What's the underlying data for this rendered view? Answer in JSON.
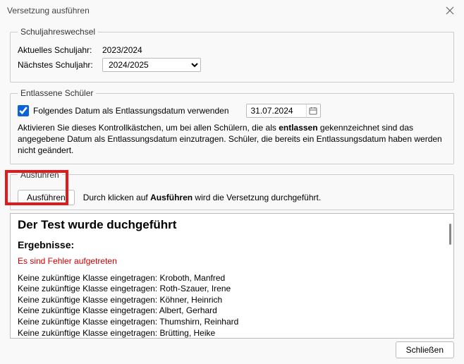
{
  "window": {
    "title": "Versetzung ausführen"
  },
  "year_change": {
    "legend": "Schuljahreswechsel",
    "current_label": "Aktuelles Schuljahr:",
    "current_value": "2023/2024",
    "next_label": "Nächstes Schuljahr:",
    "next_value": "2024/2025"
  },
  "released": {
    "legend": "Entlassene Schüler",
    "checkbox_label": "Folgendes Datum als Entlassungsdatum verwenden",
    "date_value": "31.07.2024",
    "hint_pre": "Aktivieren Sie dieses Kontrollkästchen, um bei allen Schülern, die als ",
    "hint_bold": "entlassen",
    "hint_post": " gekennzeichnet sind das angegebene Datum als Entlassungsdatum einzutragen. Schüler, die bereits ein Entlassungsdatum haben werden nicht geändert."
  },
  "execute": {
    "legend": "Ausführen",
    "button": "Ausführen",
    "hint_pre": "Durch klicken auf ",
    "hint_bold": "Ausführen",
    "hint_post": " wird die Versetzung durchgeführt."
  },
  "results": {
    "title": "Der Test wurde duchgeführt",
    "subtitle": "Ergebnisse:",
    "error_summary": "Es sind Fehler aufgetreten",
    "lines_prefix": "Keine zukünftige Klasse eingetragen: ",
    "lines": [
      "Kroboth, Manfred",
      "Roth-Szauer, Irene",
      "Köhner, Heinrich",
      "Albert, Gerhard",
      "Thumshirn, Reinhard",
      "Brütting, Heike"
    ]
  },
  "footer": {
    "close": "Schließen"
  }
}
